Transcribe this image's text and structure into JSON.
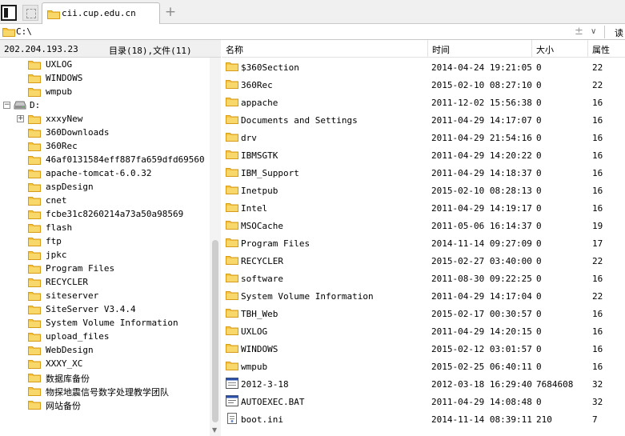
{
  "tabs": {
    "active_label": "cii.cup.edu.cn",
    "new_tab_symbol": "+"
  },
  "address": {
    "path": "C:\\",
    "plus_symbol": "±",
    "chevron": "∨",
    "read_label": "读"
  },
  "left_pane": {
    "ip": "202.204.193.23",
    "counts": "目录(18),文件(11)",
    "tree": [
      {
        "label": "UXLOG",
        "type": "folder",
        "indent": 1
      },
      {
        "label": "WINDOWS",
        "type": "folder",
        "indent": 1
      },
      {
        "label": "wmpub",
        "type": "folder",
        "indent": 1
      },
      {
        "label": "D:",
        "type": "drive",
        "indent": 0,
        "expander": "−"
      },
      {
        "label": "xxxyNew",
        "type": "folder",
        "indent": 1,
        "expander": "+"
      },
      {
        "label": "360Downloads",
        "type": "folder",
        "indent": 1
      },
      {
        "label": "360Rec",
        "type": "folder",
        "indent": 1
      },
      {
        "label": "46af0131584eff887fa659dfd69560",
        "type": "folder",
        "indent": 1
      },
      {
        "label": "apache-tomcat-6.0.32",
        "type": "folder",
        "indent": 1
      },
      {
        "label": "aspDesign",
        "type": "folder",
        "indent": 1
      },
      {
        "label": "cnet",
        "type": "folder",
        "indent": 1
      },
      {
        "label": "fcbe31c8260214a73a50a98569",
        "type": "folder",
        "indent": 1
      },
      {
        "label": "flash",
        "type": "folder",
        "indent": 1
      },
      {
        "label": "ftp",
        "type": "folder",
        "indent": 1
      },
      {
        "label": "jpkc",
        "type": "folder",
        "indent": 1
      },
      {
        "label": "Program Files",
        "type": "folder",
        "indent": 1
      },
      {
        "label": "RECYCLER",
        "type": "folder",
        "indent": 1
      },
      {
        "label": "siteserver",
        "type": "folder",
        "indent": 1
      },
      {
        "label": "SiteServer V3.4.4",
        "type": "folder",
        "indent": 1
      },
      {
        "label": "System Volume Information",
        "type": "folder",
        "indent": 1
      },
      {
        "label": "upload_files",
        "type": "folder",
        "indent": 1
      },
      {
        "label": "WebDesign",
        "type": "folder",
        "indent": 1
      },
      {
        "label": "XXXY_XC",
        "type": "folder",
        "indent": 1
      },
      {
        "label": "数据库备份",
        "type": "folder",
        "indent": 1
      },
      {
        "label": "物探地震信号数字处理教学团队",
        "type": "folder",
        "indent": 1
      },
      {
        "label": "网站备份",
        "type": "folder",
        "indent": 1
      }
    ]
  },
  "right_pane": {
    "columns": {
      "name": "名称",
      "time": "时间",
      "size": "大小",
      "attr": "属性"
    },
    "files": [
      {
        "name": "$360Section",
        "time": "2014-04-24 19:21:05",
        "size": "0",
        "attr": "22",
        "icon": "folder-icon"
      },
      {
        "name": "360Rec",
        "time": "2015-02-10 08:27:10",
        "size": "0",
        "attr": "22",
        "icon": "folder-icon"
      },
      {
        "name": "appache",
        "time": "2011-12-02 15:56:38",
        "size": "0",
        "attr": "16",
        "icon": "folder-icon"
      },
      {
        "name": "Documents and Settings",
        "time": "2011-04-29 14:17:07",
        "size": "0",
        "attr": "16",
        "icon": "folder-icon"
      },
      {
        "name": "drv",
        "time": "2011-04-29 21:54:16",
        "size": "0",
        "attr": "16",
        "icon": "folder-icon"
      },
      {
        "name": "IBMSGTK",
        "time": "2011-04-29 14:20:22",
        "size": "0",
        "attr": "16",
        "icon": "folder-icon"
      },
      {
        "name": "IBM_Support",
        "time": "2011-04-29 14:18:37",
        "size": "0",
        "attr": "16",
        "icon": "folder-icon"
      },
      {
        "name": "Inetpub",
        "time": "2015-02-10 08:28:13",
        "size": "0",
        "attr": "16",
        "icon": "folder-icon"
      },
      {
        "name": "Intel",
        "time": "2011-04-29 14:19:17",
        "size": "0",
        "attr": "16",
        "icon": "folder-icon"
      },
      {
        "name": "MSOCache",
        "time": "2011-05-06 16:14:37",
        "size": "0",
        "attr": "19",
        "icon": "folder-icon"
      },
      {
        "name": "Program Files",
        "time": "2014-11-14 09:27:09",
        "size": "0",
        "attr": "17",
        "icon": "folder-icon"
      },
      {
        "name": "RECYCLER",
        "time": "2015-02-27 03:40:00",
        "size": "0",
        "attr": "22",
        "icon": "folder-icon"
      },
      {
        "name": "software",
        "time": "2011-08-30 09:22:25",
        "size": "0",
        "attr": "16",
        "icon": "folder-icon"
      },
      {
        "name": "System Volume Information",
        "time": "2011-04-29 14:17:04",
        "size": "0",
        "attr": "22",
        "icon": "folder-icon"
      },
      {
        "name": "TBH_Web",
        "time": "2015-02-17 00:30:57",
        "size": "0",
        "attr": "16",
        "icon": "folder-icon"
      },
      {
        "name": "UXLOG",
        "time": "2011-04-29 14:20:15",
        "size": "0",
        "attr": "16",
        "icon": "folder-icon"
      },
      {
        "name": "WINDOWS",
        "time": "2015-02-12 03:01:57",
        "size": "0",
        "attr": "16",
        "icon": "folder-icon"
      },
      {
        "name": "wmpub",
        "time": "2015-02-25 06:40:11",
        "size": "0",
        "attr": "16",
        "icon": "folder-icon"
      },
      {
        "name": "2012-3-18",
        "time": "2012-03-18 16:29:40",
        "size": "7684608",
        "attr": "32",
        "icon": "file-icon"
      },
      {
        "name": "AUTOEXEC.BAT",
        "time": "2011-04-29 14:08:48",
        "size": "0",
        "attr": "32",
        "icon": "bat-file-icon"
      },
      {
        "name": "boot.ini",
        "time": "2014-11-14 08:39:11",
        "size": "210",
        "attr": "7",
        "icon": "ini-file-icon"
      }
    ]
  },
  "colors": {
    "folder": "#f4c542",
    "folder_dark": "#d79b17",
    "pane_bg": "#f0f0f0",
    "border": "#c8c8c8"
  }
}
